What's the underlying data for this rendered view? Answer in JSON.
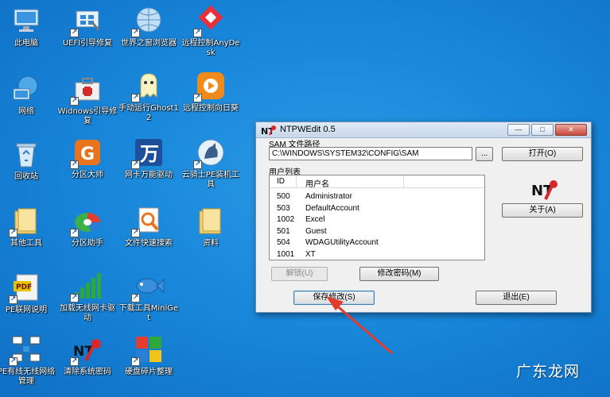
{
  "desktop": {
    "icons": [
      {
        "label": "此电脑"
      },
      {
        "label": "UEFI引导修复"
      },
      {
        "label": "世界之窗浏览器"
      },
      {
        "label": "远程控制AnyDesk"
      },
      {
        "label": "网络"
      },
      {
        "label": "Widnows引导修复"
      },
      {
        "label": "手动运行Ghost12"
      },
      {
        "label": "远程控制向日葵"
      },
      {
        "label": "回收站"
      },
      {
        "label": "分区大师"
      },
      {
        "label": "网卡万能驱动"
      },
      {
        "label": "云骑士PE装机工具"
      },
      {
        "label": "其他工具"
      },
      {
        "label": "分区助手"
      },
      {
        "label": "文件快速搜索"
      },
      {
        "label": "资料"
      },
      {
        "label": "PE联网说明"
      },
      {
        "label": "加载无线网卡驱动"
      },
      {
        "label": "下载工具MiniGet"
      },
      {
        "label": "PE有线无线网络管理"
      },
      {
        "label": "清除系统密码"
      },
      {
        "label": "硬盘碎片整理"
      }
    ]
  },
  "window": {
    "title": "NTPWEdit 0.5",
    "controls": {
      "minimize": "—",
      "maximize": "□",
      "close": "✕"
    },
    "sam_label": "SAM 文件路径",
    "sam_path": "C:\\WINDOWS\\SYSTEM32\\CONFIG\\SAM",
    "browse_label": "...",
    "open_label": "打开(O)",
    "userlist_label": "用户列表",
    "columns": {
      "id": "ID",
      "name": "用户名"
    },
    "users": [
      {
        "id": "500",
        "name": "Administrator"
      },
      {
        "id": "503",
        "name": "DefaultAccount"
      },
      {
        "id": "1002",
        "name": "Excel"
      },
      {
        "id": "501",
        "name": "Guest"
      },
      {
        "id": "504",
        "name": "WDAGUtilityAccount"
      },
      {
        "id": "1001",
        "name": "XT"
      }
    ],
    "logo_text": "NT",
    "about_label": "关于(A)",
    "unlock_label": "解锁(U)",
    "change_password_label": "修改密码(M)",
    "save_label": "保存修改(S)",
    "exit_label": "退出(E)"
  },
  "watermark": "广东龙网",
  "colors": {
    "desktop": "#1784d8",
    "arrow": "#e23b2e"
  }
}
